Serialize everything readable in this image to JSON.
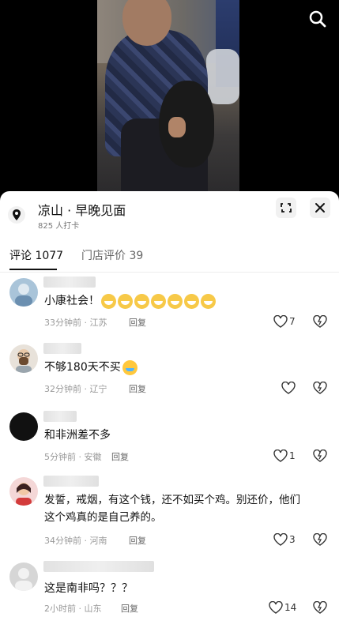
{
  "location": {
    "name": "凉山 · 早晚见面",
    "checkins": "825 人打卡"
  },
  "tabs": [
    {
      "label": "评论 1077",
      "active": true
    },
    {
      "label": "门店评价 39",
      "active": false
    }
  ],
  "comments": [
    {
      "text": "小康社会！",
      "emoji_count": 7,
      "time": "33分钟前",
      "region": "江苏",
      "reply": "回复",
      "likes": "7"
    },
    {
      "text": "不够180天不买",
      "emoji_count": 1,
      "time": "32分钟前",
      "region": "辽宁",
      "reply": "回复",
      "likes": ""
    },
    {
      "text": "和非洲差不多",
      "emoji_count": 0,
      "time": "5分钟前",
      "region": "安徽",
      "reply": "回复",
      "likes": "1"
    },
    {
      "text_lines": [
        "发誓，戒烟，有这个钱，还不如买个鸡。别还价，他们",
        "这个鸡真的是自己养的。"
      ],
      "time": "34分钟前",
      "region": "河南",
      "reply": "回复",
      "likes": "3"
    },
    {
      "text": "这是南非吗？？？",
      "time": "2小时前",
      "region": "山东",
      "reply": "回复",
      "likes": "14"
    }
  ],
  "icons": [
    "search-icon",
    "location-pin-icon",
    "collapse-icon",
    "close-icon",
    "heart-icon",
    "broken-heart-icon"
  ],
  "colors": {
    "sheet_bg": "#ffffff",
    "text": "#111111",
    "meta": "#999999"
  }
}
